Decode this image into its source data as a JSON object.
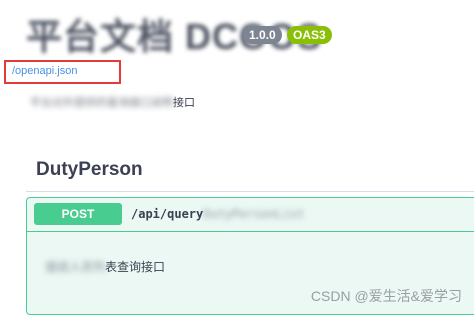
{
  "info": {
    "title": "平台文档 DCOOS",
    "version": "1.0.0",
    "oas_badge": "OAS3",
    "spec_link": "/openapi.json",
    "description_blurred": "平台对外提供的查询接口说明",
    "description_visible": "接口"
  },
  "tag": {
    "name": "DutyPerson"
  },
  "operation": {
    "method": "POST",
    "path_visible": "/api/query",
    "path_blurred": "DutyPersonList",
    "summary_blurred": "值班人员列",
    "summary_visible": "表查询接口"
  },
  "watermark": "CSDN @爱生活&爱学习",
  "colors": {
    "post": "#49cc90",
    "post_bg": "#ebf8f4",
    "highlight_box": "#e33a3a",
    "link": "#4990e2",
    "oas_badge": "#89bf04",
    "version_badge": "#7d8492"
  }
}
